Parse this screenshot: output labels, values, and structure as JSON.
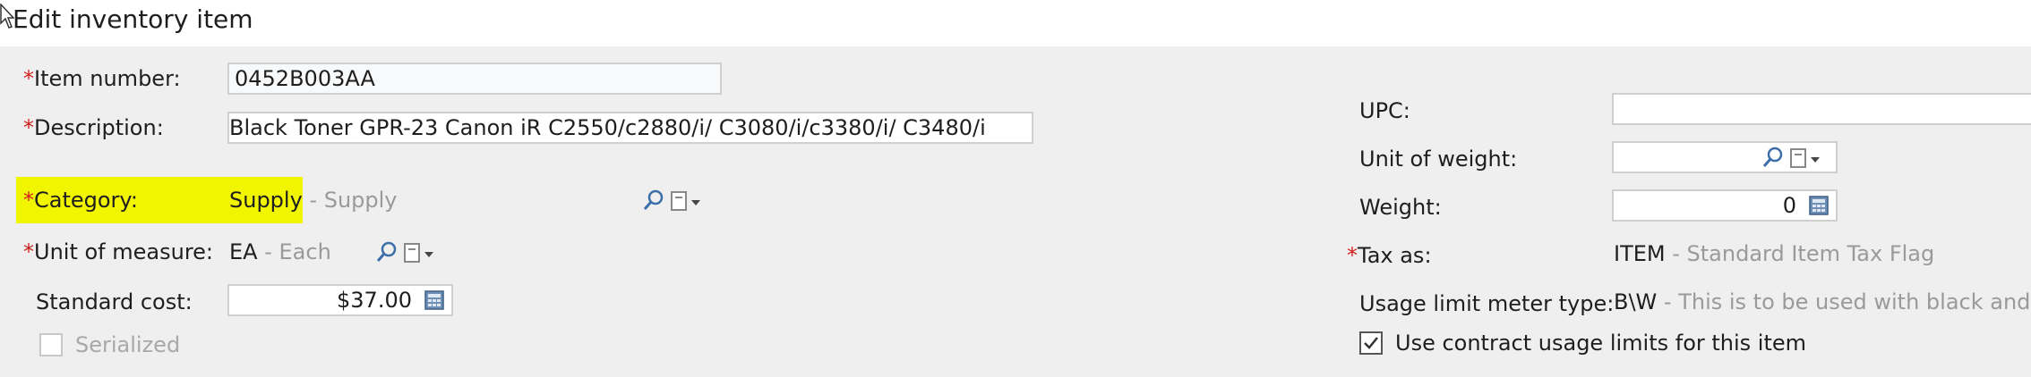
{
  "window": {
    "title": "Edit inventory item"
  },
  "required_marker": "*",
  "left": {
    "item_number": {
      "label": "Item number:",
      "value": "0452B003AA",
      "required": true
    },
    "description": {
      "label": "Description:",
      "value": "Black Toner GPR-23 Canon iR C2550/c2880/i/ C3080/i/c3380/i/ C3480/i",
      "required": true
    },
    "category": {
      "label": "Category:",
      "value": "Supply",
      "description": " - Supply",
      "required": true,
      "highlighted": true
    },
    "unit_of_measure": {
      "label": "Unit of measure:",
      "value": "EA",
      "description": " - Each",
      "required": true
    },
    "standard_cost": {
      "label": "Standard cost:",
      "value": "$37.00"
    },
    "serialized": {
      "label": "Serialized",
      "checked": false,
      "disabled": true
    }
  },
  "right": {
    "upc": {
      "label": "UPC:",
      "value": ""
    },
    "unit_of_weight": {
      "label": "Unit of weight:",
      "value": ""
    },
    "weight": {
      "label": "Weight:",
      "value": "0"
    },
    "tax_as": {
      "label": "Tax as:",
      "value": "ITEM",
      "description": " - Standard Item Tax Flag",
      "required": true
    },
    "usage_limit_meter_type": {
      "label": "Usage limit meter type:",
      "value": "B\\W",
      "description": " - This is to be used with black and wh"
    },
    "use_contract_usage_limits": {
      "label": "Use contract usage limits for this item",
      "checked": true
    }
  },
  "colors": {
    "highlight": "#f2f500",
    "required": "#d41e1e",
    "icon_blue": "#3c6ea8"
  },
  "icons": [
    "cursor-icon",
    "search-icon",
    "dropdown-icon",
    "calculator-icon",
    "checkmark-icon"
  ]
}
